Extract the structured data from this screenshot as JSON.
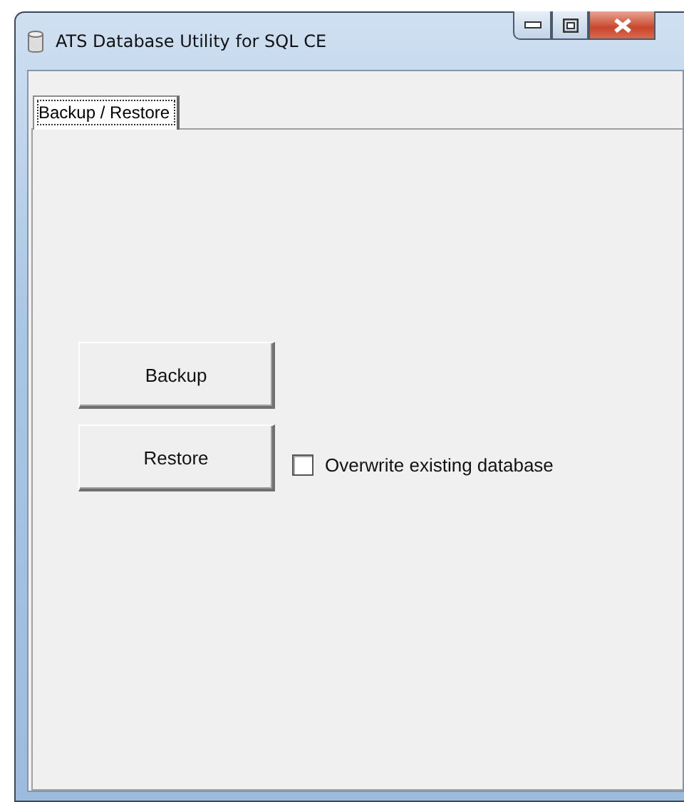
{
  "window": {
    "title": "ATS Database Utility for SQL CE"
  },
  "tabs": [
    {
      "label": "Backup / Restore",
      "selected": true
    }
  ],
  "buttons": [
    {
      "label": "Backup"
    },
    {
      "label": "Restore"
    }
  ],
  "overwrite": {
    "label": "Overwrite existing database",
    "checked": false
  }
}
